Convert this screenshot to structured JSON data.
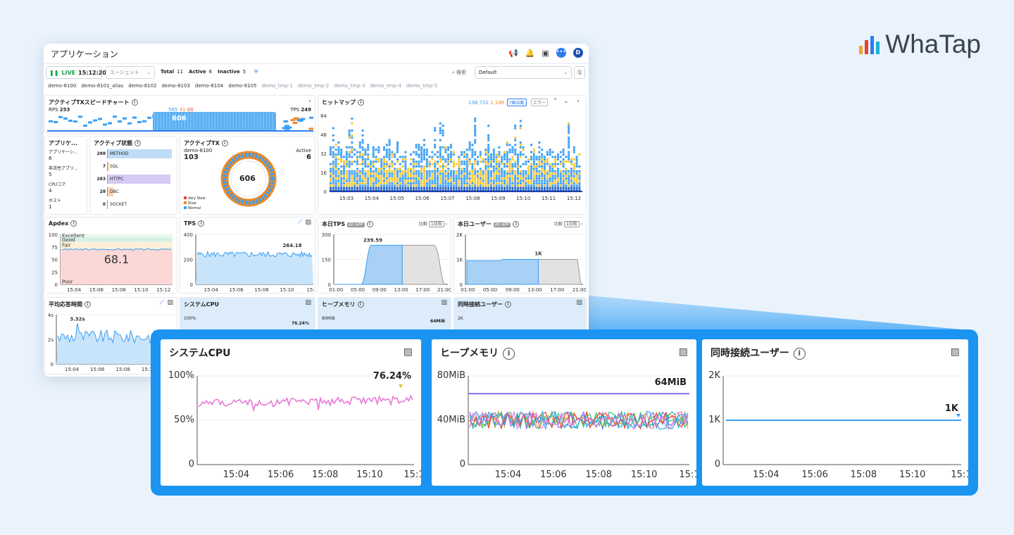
{
  "brand": {
    "name": "WhaTap",
    "bar_colors": [
      "#f5a623",
      "#e8412d",
      "#2e7df0",
      "#1bb4d6"
    ]
  },
  "window": {
    "title": "アプリケーション",
    "avatar": "D"
  },
  "toolbar": {
    "live": "LIVE",
    "time": "15:12:20",
    "agent_placeholder": "エージェント",
    "total_label": "Total",
    "total": "11",
    "active_label": "Active",
    "active": "6",
    "inactive_label": "Inactive",
    "inactive": "5",
    "search_label": "検索",
    "preset": "Default"
  },
  "agents": [
    "demo-8100",
    "demo-8101_alias",
    "demo-8102",
    "demo-8103",
    "demo-8104",
    "demo-8105",
    "demo_tmp-1",
    "demo_tmp-2",
    "demo_tmp-3",
    "demo_tmp-4",
    "demo_tmp-5"
  ],
  "speed": {
    "title": "アクティブTXスピードチャート",
    "rps_label": "RPS",
    "rps": "253",
    "tps_label": "TPS",
    "tps": "249",
    "n1": "565",
    "n2": "41",
    "n3": "00",
    "center": "606"
  },
  "heatmap": {
    "title": "ヒットマップ",
    "c1": "138,732",
    "c2": "1,198",
    "btn1": "Y軸自動",
    "btn2": "エラー",
    "yticks": [
      "64",
      "48",
      "32",
      "16",
      "0"
    ],
    "xticks": [
      "15:03",
      "15:04",
      "15:05",
      "15:06",
      "15:07",
      "15:08",
      "15:09",
      "15:10",
      "15:11",
      "15:12"
    ]
  },
  "apps": {
    "title": "アプリケ...",
    "rows": [
      {
        "label": "アプリケーシ...",
        "value": "6"
      },
      {
        "label": "非活性アプリ...",
        "value": "5"
      },
      {
        "label": "CPUコア",
        "value": "4"
      },
      {
        "label": "ホスト",
        "value": "1"
      }
    ]
  },
  "astate": {
    "title": "アクティブ状態",
    "rows": [
      {
        "n": "288",
        "label": "METHOD",
        "frac": 1.0,
        "color": "#bfdcf7"
      },
      {
        "n": "7",
        "label": "SQL",
        "frac": 0.03,
        "color": "#f6d9a8"
      },
      {
        "n": "283",
        "label": "HTTPC",
        "frac": 0.98,
        "color": "#d6c9f4"
      },
      {
        "n": "28",
        "label": "DBC",
        "frac": 0.1,
        "color": "#f7d3b5"
      },
      {
        "n": "0",
        "label": "SOCKET",
        "frac": 0,
        "color": "#e0e0e0"
      }
    ]
  },
  "atx": {
    "title": "アクティブTX",
    "agent": "demo-8100",
    "agent_value": "103",
    "active_label": "Active",
    "active_value": "6",
    "center": "606",
    "legend": [
      {
        "label": "Very Slow",
        "color": "#e8412d"
      },
      {
        "label": "Slow",
        "color": "#f08a24"
      },
      {
        "label": "Normal",
        "color": "#3a9ef5"
      }
    ]
  },
  "apdex": {
    "title": "Apdex",
    "value": "68.1",
    "yticks": [
      "100",
      "75",
      "50",
      "25",
      "0"
    ],
    "bands": [
      "Excellent",
      "Good",
      "Fair",
      "Poor"
    ],
    "xticks": [
      "15:04",
      "15:06",
      "15:08",
      "15:10",
      "15:12"
    ]
  },
  "tps": {
    "title": "TPS",
    "peak": "264.18",
    "yticks": [
      "400",
      "200",
      "0"
    ],
    "xticks": [
      "15:04",
      "15:06",
      "15:08",
      "15:10",
      "15:1"
    ]
  },
  "today_tps": {
    "title": "本日TPS",
    "tag": "All APP",
    "cmp": "比較",
    "cmp_btn": "1日前",
    "peak": "239.59",
    "yticks": [
      "300",
      "150",
      "0"
    ],
    "xticks": [
      "01:00",
      "05:00",
      "09:00",
      "13:00",
      "17:00",
      "21:00"
    ]
  },
  "today_users": {
    "title": "本日ユーザー",
    "tag": "All APP",
    "cmp": "比較",
    "cmp_btn": "1日前",
    "peak": "1K",
    "yticks": [
      "2K",
      "1K",
      "0"
    ],
    "xticks": [
      "01:00",
      "05:00",
      "09:00",
      "13:00",
      "17:00",
      "21:00"
    ]
  },
  "resp": {
    "title": "平均応答時間",
    "peak": "3.32s",
    "yticks": [
      "4s",
      "2s",
      "0"
    ],
    "xticks": [
      "15:04",
      "15:06",
      "15:08",
      "15:10"
    ]
  },
  "small_cpu": {
    "title": "システムCPU",
    "y": "100%",
    "val": "76.24%"
  },
  "small_heap": {
    "title": "ヒープメモリ",
    "y": "80MiB",
    "val": "64MiB"
  },
  "small_users": {
    "title": "同時接続ユーザー",
    "y": "2K"
  },
  "zoom_cpu": {
    "title": "システムCPU",
    "value": "76.24%",
    "yticks": [
      "100%",
      "50%",
      "0"
    ],
    "xticks": [
      "15:04",
      "15:06",
      "15:08",
      "15:10",
      "15:1"
    ]
  },
  "zoom_heap": {
    "title": "ヒープメモリ",
    "value": "64MiB",
    "yticks": [
      "80MiB",
      "40MiB",
      "0"
    ],
    "xticks": [
      "15:04",
      "15:06",
      "15:08",
      "15:10",
      "15:1"
    ]
  },
  "zoom_users": {
    "title": "同時接続ユーザー",
    "value": "1K",
    "yticks": [
      "2K",
      "1K",
      "0"
    ],
    "xticks": [
      "15:04",
      "15:06",
      "15:08",
      "15:10",
      "15:1"
    ]
  }
}
